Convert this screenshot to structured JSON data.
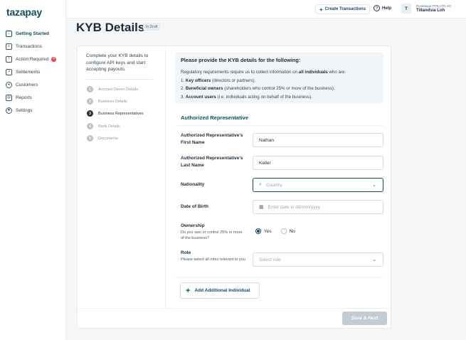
{
  "brand": {
    "logo": "tazapay"
  },
  "sidebar": {
    "items": [
      {
        "label": "Getting Started",
        "icon": "home-icon",
        "active": true
      },
      {
        "label": "Transactions",
        "icon": "transactions-icon"
      },
      {
        "label": "Action Required",
        "icon": "alert-icon",
        "badge": "4"
      },
      {
        "label": "Settlements",
        "icon": "settlements-icon"
      },
      {
        "label": "Customers",
        "icon": "customers-icon"
      },
      {
        "label": "Reports",
        "icon": "reports-icon"
      },
      {
        "label": "Settings",
        "icon": "gear-icon"
      }
    ]
  },
  "topbar": {
    "create_label": "Create Transactions",
    "help_label": "Help",
    "avatar_initial": "T",
    "org": "Revitalogic PTE LTD SG",
    "user_name": "Tillandsia Loh"
  },
  "page": {
    "title": "KYB Details",
    "status": "In Draft"
  },
  "intro": "Complete your KYB details to configure API keys and start accepting payouts.",
  "steps": [
    {
      "num": "1",
      "label": "Account Owner Details"
    },
    {
      "num": "2",
      "label": "Business Details"
    },
    {
      "num": "3",
      "label": "Business Representatives",
      "current": true
    },
    {
      "num": "4",
      "label": "Bank Details"
    },
    {
      "num": "5",
      "label": "Documents"
    }
  ],
  "info": {
    "heading": "Please provide the KYB details for the following:",
    "line1_pre": "Regulatory requirements require us to collect information on ",
    "line1_bold": "all individuals",
    "line1_post": " who are:",
    "items": [
      {
        "num": "1. ",
        "bold": "Key officers",
        "rest": " (directors or partners),"
      },
      {
        "num": "2. ",
        "bold": "Beneficial owners",
        "rest": " (shareholders who control 25% or more of the business),"
      },
      {
        "num": "3. ",
        "bold": "Account users",
        "rest": " (i.e. individuals acting on behalf of the business)."
      }
    ]
  },
  "form": {
    "section_title": "Authorized Representative",
    "first_name_label": "Authorized Representative's First Name",
    "first_name_value": "Nathan",
    "last_name_label": "Authorized Representative's Last Name",
    "last_name_value": "Keller",
    "nationality_label": "Nationality",
    "nationality_placeholder": "Country",
    "dob_label": "Date of Birth",
    "dob_placeholder": "Enter date in dd/mm/yyyy",
    "ownership_label": "Ownership",
    "ownership_sub": "Do you own or control 25% or more of the business?",
    "ownership_yes": "Yes",
    "ownership_no": "No",
    "ownership_selected": "Yes",
    "role_label": "Role",
    "role_sub": "Please select all roles relevant to you",
    "role_placeholder": "Select role",
    "add_label": "Add Additional Individual"
  },
  "footer": {
    "save_label": "Save & Next"
  },
  "colors": {
    "brand": "#0e4f5c",
    "badge": "#e5484d",
    "disabled_button": "#c4ccd3"
  }
}
